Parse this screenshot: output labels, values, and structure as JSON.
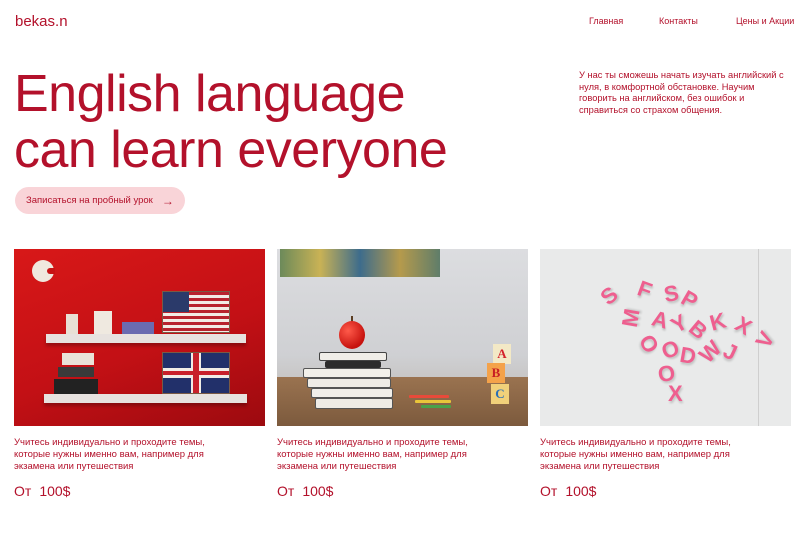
{
  "header": {
    "logo": "bekas.n",
    "nav": [
      {
        "label": "Главная"
      },
      {
        "label": "Контакты"
      },
      {
        "label": "Цены и Акции"
      }
    ]
  },
  "hero": {
    "title_line1": "English language",
    "title_line2": "can learn everyone",
    "description": "У нас ты сможешь начать изучать английский с нуля, в комфортной обстановке. Научим говорить на английском, без ошибок и справиться со страхом общения.",
    "cta_label": "Записаться на пробный урок",
    "cta_icon": "arrow-right-icon"
  },
  "cards": [
    {
      "description": "Учитесь индивидуально и проходите темы, которые нужны именно вам, например для экзамена или путешествия",
      "price_prefix": "От",
      "price": "100$"
    },
    {
      "description": "Учитесь индивидуально и проходите темы, которые нужны именно вам, например для экзамена или путешествия",
      "price_prefix": "От",
      "price": "100$"
    },
    {
      "description": "Учитесь индивидуально и проходите темы, которые нужны именно вам, например для экзамена или путешествия",
      "price_prefix": "От",
      "price": "100$"
    }
  ],
  "colors": {
    "accent": "#b3112b",
    "button_bg": "#f9d4d8",
    "background": "#ffffff"
  }
}
